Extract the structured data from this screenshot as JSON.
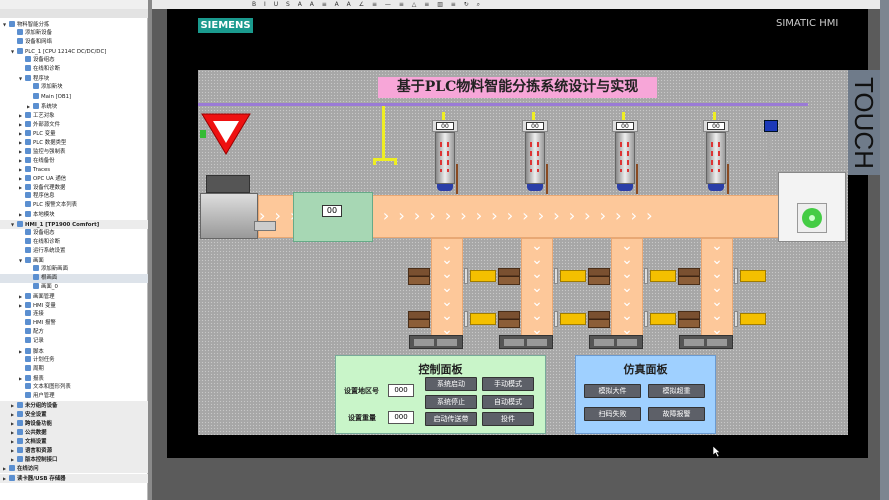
{
  "tree": [
    {
      "label": "物料智能分拣",
      "level": 0,
      "exp": "▼"
    },
    {
      "label": "添加新设备",
      "level": 1
    },
    {
      "label": "设备和网络",
      "level": 1
    },
    {
      "label": "PLC_1 [CPU 1214C DC/DC/DC]",
      "level": 1,
      "exp": "▼"
    },
    {
      "label": "设备组态",
      "level": 2
    },
    {
      "label": "在线和诊断",
      "level": 2
    },
    {
      "label": "程序块",
      "level": 2,
      "exp": "▼"
    },
    {
      "label": "添加新块",
      "level": 3
    },
    {
      "label": "Main [OB1]",
      "level": 3
    },
    {
      "label": "系统块",
      "level": 3,
      "exp": "▶"
    },
    {
      "label": "工艺对象",
      "level": 2,
      "exp": "▶"
    },
    {
      "label": "外部源文件",
      "level": 2,
      "exp": "▶"
    },
    {
      "label": "PLC 变量",
      "level": 2,
      "exp": "▶"
    },
    {
      "label": "PLC 数据类型",
      "level": 2,
      "exp": "▶"
    },
    {
      "label": "监控与强制表",
      "level": 2,
      "exp": "▶"
    },
    {
      "label": "在线备份",
      "level": 2,
      "exp": "▶"
    },
    {
      "label": "Traces",
      "level": 2,
      "exp": "▶"
    },
    {
      "label": "OPC UA 通信",
      "level": 2,
      "exp": "▶"
    },
    {
      "label": "设备代理数据",
      "level": 2,
      "exp": "▶"
    },
    {
      "label": "程序信息",
      "level": 2
    },
    {
      "label": "PLC 报警文本列表",
      "level": 2
    },
    {
      "label": "本地模块",
      "level": 2,
      "exp": "▶"
    },
    {
      "label": "HMI_1 [TP1900 Comfort]",
      "level": 1,
      "exp": "▼",
      "grp": true
    },
    {
      "label": "设备组态",
      "level": 2
    },
    {
      "label": "在线和诊断",
      "level": 2
    },
    {
      "label": "运行系统设置",
      "level": 2
    },
    {
      "label": "画面",
      "level": 2,
      "exp": "▼"
    },
    {
      "label": "添加新画面",
      "level": 3
    },
    {
      "label": "根画面",
      "level": 3,
      "sel": true
    },
    {
      "label": "画面_0",
      "level": 3
    },
    {
      "label": "画面管理",
      "level": 2,
      "exp": "▶"
    },
    {
      "label": "HMI 变量",
      "level": 2,
      "exp": "▶"
    },
    {
      "label": "连接",
      "level": 2
    },
    {
      "label": "HMI 报警",
      "level": 2
    },
    {
      "label": "配方",
      "level": 2
    },
    {
      "label": "记录",
      "level": 2
    },
    {
      "label": "脚本",
      "level": 2,
      "exp": "▶"
    },
    {
      "label": "计划任务",
      "level": 2
    },
    {
      "label": "周期",
      "level": 2
    },
    {
      "label": "报表",
      "level": 2,
      "exp": "▶"
    },
    {
      "label": "文本和图形列表",
      "level": 2
    },
    {
      "label": "用户管理",
      "level": 2
    },
    {
      "label": "未分组的设备",
      "level": 1,
      "exp": "▶",
      "grp": true
    },
    {
      "label": "安全设置",
      "level": 1,
      "exp": "▶",
      "grp": true
    },
    {
      "label": "跨设备功能",
      "level": 1,
      "exp": "▶",
      "grp": true
    },
    {
      "label": "公共数据",
      "level": 1,
      "exp": "▶",
      "grp": true
    },
    {
      "label": "文档设置",
      "level": 1,
      "exp": "▶",
      "grp": true
    },
    {
      "label": "语言和资源",
      "level": 1,
      "exp": "▶",
      "grp": true
    },
    {
      "label": "版本控制接口",
      "level": 1,
      "exp": "▶",
      "grp": true
    },
    {
      "label": "在线访问",
      "level": 0,
      "exp": "▶",
      "grp": true
    },
    {
      "label": "读卡器/USB 存储器",
      "level": 0,
      "exp": "▶",
      "grp": true
    }
  ],
  "toolbar": {
    "format_icons": "B I U S A A ≡ A A ∠ ≡ — ≡ △ ≡ ▥ ≡ ↻ ⌕"
  },
  "hmi": {
    "brand": "SIEMENS",
    "model": "SIMATIC HMI",
    "touch": "TOUCH",
    "title": "基于PLC物料智能分拣系统设计与实现",
    "sorter_display": "00",
    "silo_displays": [
      "00",
      "00",
      "00",
      "00"
    ],
    "conveyor_arrows": "› › › › › › › › › › › › › › › › › › › › › › › › › ›",
    "branch_arrows": "⌄<br>"
  },
  "control_panel": {
    "title": "控制面板",
    "area_label": "设置地区号",
    "area_value": "000",
    "weight_label": "设置重量",
    "weight_value": "000",
    "buttons": [
      "系统启动",
      "手动模式",
      "系统停止",
      "自动模式",
      "启动传送带",
      "投件"
    ]
  },
  "sim_panel": {
    "title": "仿真面板",
    "buttons": [
      "模拟大件",
      "模拟超重",
      "扫码失败",
      "故障报警"
    ]
  },
  "colors": {
    "conveyor": "#fdc89a",
    "control_bg": "#c9f5c9",
    "sim_bg": "#9fd0ff",
    "title_bg": "#f7a6d8",
    "siemens": "#1a9a8e"
  }
}
